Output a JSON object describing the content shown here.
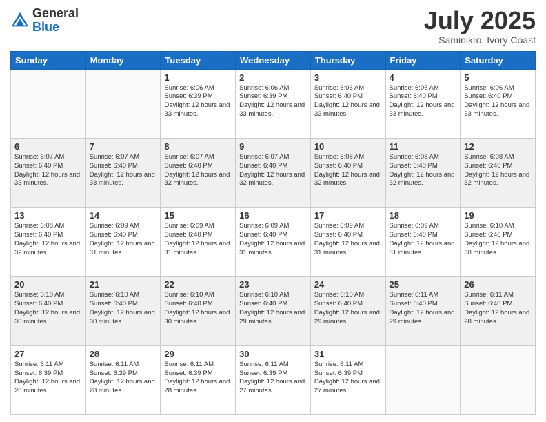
{
  "header": {
    "logo_general": "General",
    "logo_blue": "Blue",
    "month_title": "July 2025",
    "subtitle": "Saminikro, Ivory Coast"
  },
  "days_of_week": [
    "Sunday",
    "Monday",
    "Tuesday",
    "Wednesday",
    "Thursday",
    "Friday",
    "Saturday"
  ],
  "weeks": [
    [
      {
        "day": "",
        "sunrise": "",
        "sunset": "",
        "daylight": ""
      },
      {
        "day": "",
        "sunrise": "",
        "sunset": "",
        "daylight": ""
      },
      {
        "day": "1",
        "sunrise": "Sunrise: 6:06 AM",
        "sunset": "Sunset: 6:39 PM",
        "daylight": "Daylight: 12 hours and 33 minutes."
      },
      {
        "day": "2",
        "sunrise": "Sunrise: 6:06 AM",
        "sunset": "Sunset: 6:39 PM",
        "daylight": "Daylight: 12 hours and 33 minutes."
      },
      {
        "day": "3",
        "sunrise": "Sunrise: 6:06 AM",
        "sunset": "Sunset: 6:40 PM",
        "daylight": "Daylight: 12 hours and 33 minutes."
      },
      {
        "day": "4",
        "sunrise": "Sunrise: 6:06 AM",
        "sunset": "Sunset: 6:40 PM",
        "daylight": "Daylight: 12 hours and 33 minutes."
      },
      {
        "day": "5",
        "sunrise": "Sunrise: 6:06 AM",
        "sunset": "Sunset: 6:40 PM",
        "daylight": "Daylight: 12 hours and 33 minutes."
      }
    ],
    [
      {
        "day": "6",
        "sunrise": "Sunrise: 6:07 AM",
        "sunset": "Sunset: 6:40 PM",
        "daylight": "Daylight: 12 hours and 33 minutes."
      },
      {
        "day": "7",
        "sunrise": "Sunrise: 6:07 AM",
        "sunset": "Sunset: 6:40 PM",
        "daylight": "Daylight: 12 hours and 33 minutes."
      },
      {
        "day": "8",
        "sunrise": "Sunrise: 6:07 AM",
        "sunset": "Sunset: 6:40 PM",
        "daylight": "Daylight: 12 hours and 32 minutes."
      },
      {
        "day": "9",
        "sunrise": "Sunrise: 6:07 AM",
        "sunset": "Sunset: 6:40 PM",
        "daylight": "Daylight: 12 hours and 32 minutes."
      },
      {
        "day": "10",
        "sunrise": "Sunrise: 6:08 AM",
        "sunset": "Sunset: 6:40 PM",
        "daylight": "Daylight: 12 hours and 32 minutes."
      },
      {
        "day": "11",
        "sunrise": "Sunrise: 6:08 AM",
        "sunset": "Sunset: 6:40 PM",
        "daylight": "Daylight: 12 hours and 32 minutes."
      },
      {
        "day": "12",
        "sunrise": "Sunrise: 6:08 AM",
        "sunset": "Sunset: 6:40 PM",
        "daylight": "Daylight: 12 hours and 32 minutes."
      }
    ],
    [
      {
        "day": "13",
        "sunrise": "Sunrise: 6:08 AM",
        "sunset": "Sunset: 6:40 PM",
        "daylight": "Daylight: 12 hours and 32 minutes."
      },
      {
        "day": "14",
        "sunrise": "Sunrise: 6:09 AM",
        "sunset": "Sunset: 6:40 PM",
        "daylight": "Daylight: 12 hours and 31 minutes."
      },
      {
        "day": "15",
        "sunrise": "Sunrise: 6:09 AM",
        "sunset": "Sunset: 6:40 PM",
        "daylight": "Daylight: 12 hours and 31 minutes."
      },
      {
        "day": "16",
        "sunrise": "Sunrise: 6:09 AM",
        "sunset": "Sunset: 6:40 PM",
        "daylight": "Daylight: 12 hours and 31 minutes."
      },
      {
        "day": "17",
        "sunrise": "Sunrise: 6:09 AM",
        "sunset": "Sunset: 6:40 PM",
        "daylight": "Daylight: 12 hours and 31 minutes."
      },
      {
        "day": "18",
        "sunrise": "Sunrise: 6:09 AM",
        "sunset": "Sunset: 6:40 PM",
        "daylight": "Daylight: 12 hours and 31 minutes."
      },
      {
        "day": "19",
        "sunrise": "Sunrise: 6:10 AM",
        "sunset": "Sunset: 6:40 PM",
        "daylight": "Daylight: 12 hours and 30 minutes."
      }
    ],
    [
      {
        "day": "20",
        "sunrise": "Sunrise: 6:10 AM",
        "sunset": "Sunset: 6:40 PM",
        "daylight": "Daylight: 12 hours and 30 minutes."
      },
      {
        "day": "21",
        "sunrise": "Sunrise: 6:10 AM",
        "sunset": "Sunset: 6:40 PM",
        "daylight": "Daylight: 12 hours and 30 minutes."
      },
      {
        "day": "22",
        "sunrise": "Sunrise: 6:10 AM",
        "sunset": "Sunset: 6:40 PM",
        "daylight": "Daylight: 12 hours and 30 minutes."
      },
      {
        "day": "23",
        "sunrise": "Sunrise: 6:10 AM",
        "sunset": "Sunset: 6:40 PM",
        "daylight": "Daylight: 12 hours and 29 minutes."
      },
      {
        "day": "24",
        "sunrise": "Sunrise: 6:10 AM",
        "sunset": "Sunset: 6:40 PM",
        "daylight": "Daylight: 12 hours and 29 minutes."
      },
      {
        "day": "25",
        "sunrise": "Sunrise: 6:11 AM",
        "sunset": "Sunset: 6:40 PM",
        "daylight": "Daylight: 12 hours and 29 minutes."
      },
      {
        "day": "26",
        "sunrise": "Sunrise: 6:11 AM",
        "sunset": "Sunset: 6:40 PM",
        "daylight": "Daylight: 12 hours and 28 minutes."
      }
    ],
    [
      {
        "day": "27",
        "sunrise": "Sunrise: 6:11 AM",
        "sunset": "Sunset: 6:39 PM",
        "daylight": "Daylight: 12 hours and 28 minutes."
      },
      {
        "day": "28",
        "sunrise": "Sunrise: 6:11 AM",
        "sunset": "Sunset: 6:39 PM",
        "daylight": "Daylight: 12 hours and 28 minutes."
      },
      {
        "day": "29",
        "sunrise": "Sunrise: 6:11 AM",
        "sunset": "Sunset: 6:39 PM",
        "daylight": "Daylight: 12 hours and 28 minutes."
      },
      {
        "day": "30",
        "sunrise": "Sunrise: 6:11 AM",
        "sunset": "Sunset: 6:39 PM",
        "daylight": "Daylight: 12 hours and 27 minutes."
      },
      {
        "day": "31",
        "sunrise": "Sunrise: 6:11 AM",
        "sunset": "Sunset: 6:39 PM",
        "daylight": "Daylight: 12 hours and 27 minutes."
      },
      {
        "day": "",
        "sunrise": "",
        "sunset": "",
        "daylight": ""
      },
      {
        "day": "",
        "sunrise": "",
        "sunset": "",
        "daylight": ""
      }
    ]
  ]
}
